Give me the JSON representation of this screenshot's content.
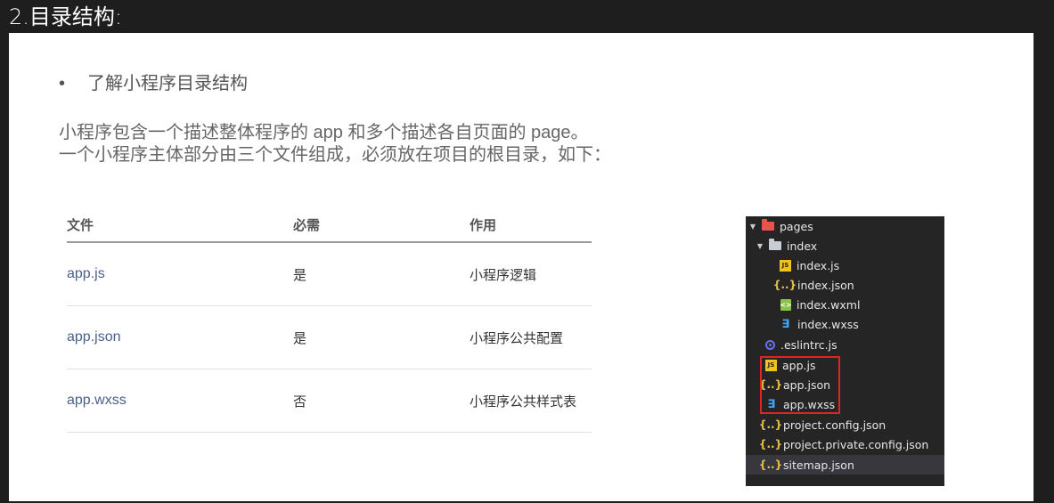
{
  "heading": "2.目录结构:",
  "bullet": "了解小程序目录结构",
  "bullet_marker": "•",
  "description": [
    "小程序包含一个描述整体程序的 app 和多个描述各自页面的 page。",
    "一个小程序主体部分由三个文件组成，必须放在项目的根目录，如下："
  ],
  "table": {
    "headers": [
      "文件",
      "必需",
      "作用"
    ],
    "rows": [
      [
        "app.js",
        "是",
        "小程序逻辑"
      ],
      [
        "app.json",
        "是",
        "小程序公共配置"
      ],
      [
        "app.wxss",
        "否",
        "小程序公共样式表"
      ]
    ]
  },
  "tree": {
    "items": [
      {
        "label": "pages",
        "icon": "folder-red-icon"
      },
      {
        "label": "index",
        "icon": "folder-icon"
      },
      {
        "label": "index.js",
        "icon": "js-file-icon"
      },
      {
        "label": "index.json",
        "icon": "json-file-icon"
      },
      {
        "label": "index.wxml",
        "icon": "wxml-file-icon"
      },
      {
        "label": "index.wxss",
        "icon": "wxss-file-icon"
      },
      {
        "label": ".eslintrc.js",
        "icon": "eslint-icon"
      },
      {
        "label": "app.js",
        "icon": "js-file-icon"
      },
      {
        "label": "app.json",
        "icon": "json-file-icon"
      },
      {
        "label": "app.wxss",
        "icon": "wxss-file-icon"
      },
      {
        "label": "project.config.json",
        "icon": "json-file-icon"
      },
      {
        "label": "project.private.config.json",
        "icon": "json-file-icon"
      },
      {
        "label": "sitemap.json",
        "icon": "json-file-icon"
      }
    ],
    "highlight_color": "#e02424"
  }
}
